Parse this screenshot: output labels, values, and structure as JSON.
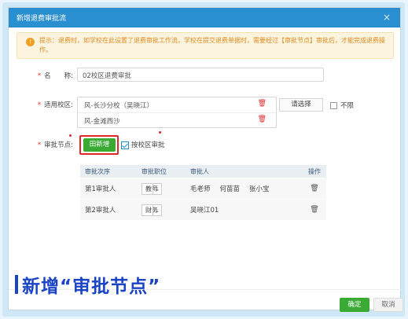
{
  "dialog": {
    "title": "新增退费审批流",
    "close_icon": "×"
  },
  "notice": {
    "icon": "!",
    "text": "提示：退费时，如学校在此设置了退费审批工作流，学校在提交退费单据时，需要经过【审批节点】审批后，才能完成退费操作。"
  },
  "form": {
    "name_label": "名　　称:",
    "name_value": "02校区退费审批",
    "school_label": "适用校区:",
    "schools": [
      {
        "name": "风-长沙分校（吴晓江）"
      },
      {
        "name": "风-金滩西沙"
      }
    ],
    "select_button": "请选择",
    "unlimited_label": "不限",
    "node_label": "审批节点:",
    "add_button": "田新增",
    "by_school_label": "按校区审批"
  },
  "table": {
    "headers": [
      "审批次序",
      "审批职位",
      "审批人",
      "操作"
    ],
    "rows": [
      {
        "order": "第1审批人",
        "position": "教师",
        "approvers": [
          "毛老师",
          "何苗苗",
          "张小宝"
        ]
      },
      {
        "order": "第2审批人",
        "position": "财务",
        "approvers": [
          "吴晓江01"
        ]
      }
    ]
  },
  "caption": "新增“审批节点”",
  "footer": {
    "ok": "确定",
    "cancel": "取消"
  },
  "colors": {
    "title_bar": "#2a8fd0",
    "primary_green": "#3aaa35",
    "highlight_red": "#e0262b",
    "caption_blue": "#1a44c4"
  }
}
